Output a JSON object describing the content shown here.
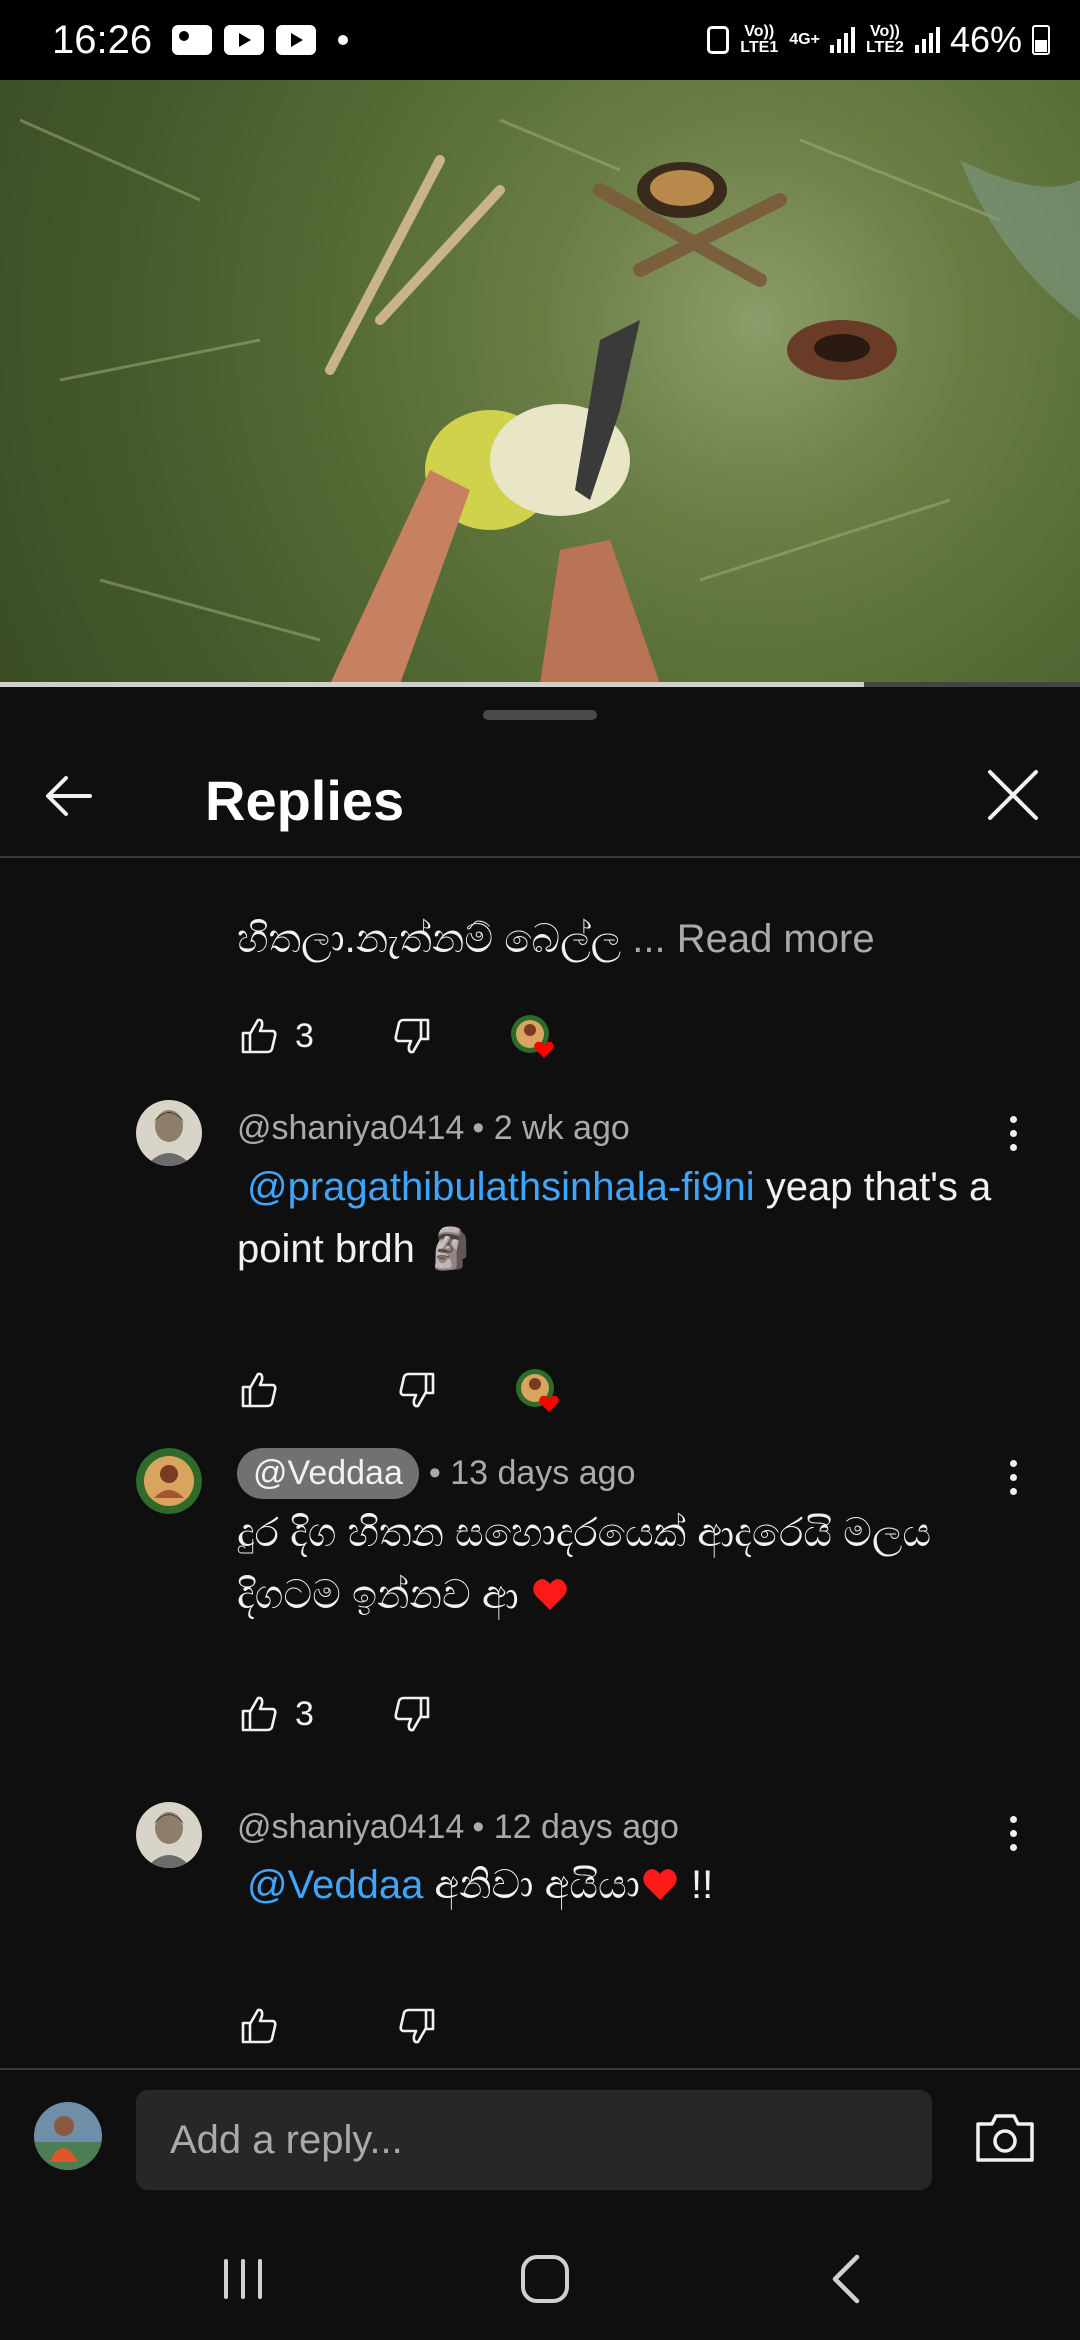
{
  "status_bar": {
    "time": "16:26",
    "network_1": "Vo)) LTE1",
    "network_gen": "4G+",
    "network_2": "Vo)) LTE2",
    "battery": "46%"
  },
  "video": {
    "progress": 0.8
  },
  "sheet": {
    "title": "Replies"
  },
  "comments": [
    {
      "partial_text": "හිතලා.නැත්නම් බෙල්ල",
      "read_more": "... Read more",
      "likes": "3",
      "hearted": true
    },
    {
      "handle": "@shaniya0414",
      "time": "• 2 wk ago",
      "mention": "@pragathibulathsinhala-fi9ni",
      "text": " yeap that's a point brdh 🗿",
      "likes": "",
      "hearted": true
    },
    {
      "handle": "@Veddaa",
      "time": "• 13 days ago",
      "text": "දුර දිග හිතන සහොදරයෙක් ආදරෙයි මලය දිගටම ඉන්නව ආ",
      "likes": "3",
      "hearted": false
    },
    {
      "handle": "@shaniya0414",
      "time": "• 12 days ago",
      "mention": "@Veddaa",
      "text": " අනිවා අයියා",
      "text_after": " !!",
      "likes": "",
      "hearted": false
    }
  ],
  "reply_bar": {
    "placeholder": "Add a reply..."
  },
  "colors": {
    "link": "#3ea6ff",
    "background": "#0f0f0f",
    "heart": "#ff0000"
  },
  "icons": [
    "back-arrow-icon",
    "close-icon",
    "like-icon",
    "dislike-icon",
    "more-vert-icon",
    "camera-icon",
    "recents-icon",
    "home-icon",
    "back-icon"
  ]
}
